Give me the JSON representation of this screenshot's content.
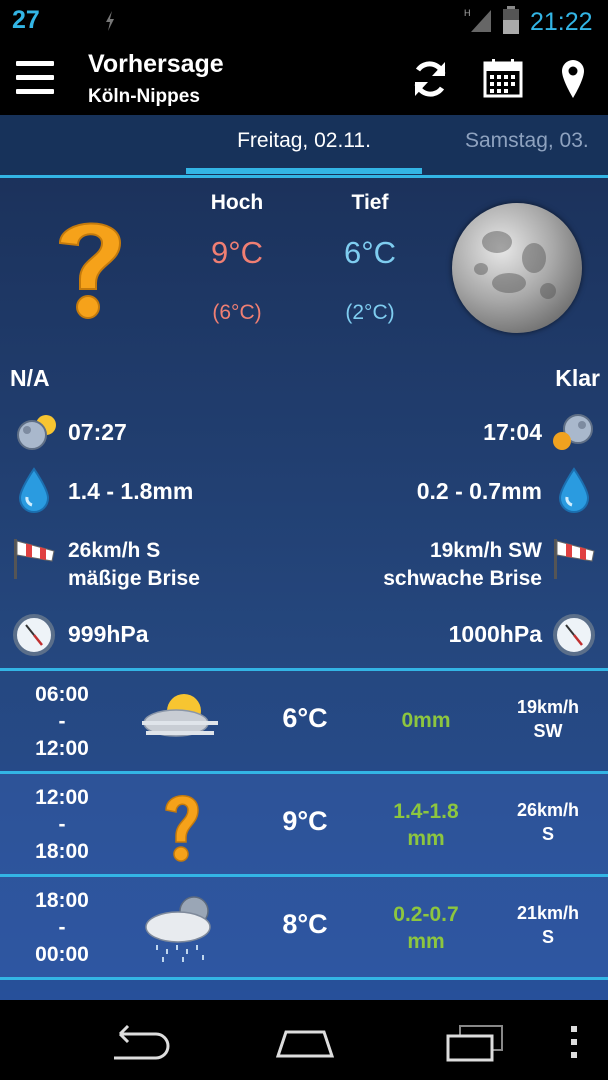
{
  "status_bar": {
    "notification_count": "27",
    "network_type": "H",
    "time": "21:22"
  },
  "app_bar": {
    "title": "Vorhersage",
    "subtitle": "Köln-Nippes",
    "actions": [
      "refresh-icon",
      "calendar-icon",
      "location-pin-icon"
    ]
  },
  "tabs": {
    "active": "Freitag, 02.11.",
    "next": "Samstag, 03."
  },
  "summary": {
    "high_label": "Hoch",
    "low_label": "Tief",
    "high_temp": "9°C",
    "low_temp": "6°C",
    "high_feels": "(6°C)",
    "low_feels": "(2°C)",
    "day_condition": "N/A",
    "night_condition": "Klar",
    "sunrise": "07:27",
    "sunset": "17:04",
    "precip_day": "1.4 - 1.8mm",
    "precip_night": "0.2 - 0.7mm",
    "wind_day_speed": "26km/h S",
    "wind_day_desc": "mäßige Brise",
    "wind_night_speed": "19km/h SW",
    "wind_night_desc": "schwache Brise",
    "pressure_day": "999hPa",
    "pressure_night": "1000hPa"
  },
  "forecast": [
    {
      "from": "06:00",
      "sep": "-",
      "to": "12:00",
      "icon": "partly-cloudy-fog-icon",
      "temp": "6°C",
      "precip_1": "0mm",
      "precip_2": "",
      "wind_speed": "19km/h",
      "wind_dir": "SW"
    },
    {
      "from": "12:00",
      "sep": "-",
      "to": "18:00",
      "icon": "unknown-question-icon",
      "temp": "9°C",
      "precip_1": "1.4-1.8",
      "precip_2": "mm",
      "wind_speed": "26km/h",
      "wind_dir": "S"
    },
    {
      "from": "18:00",
      "sep": "-",
      "to": "00:00",
      "icon": "night-cloud-rain-icon",
      "temp": "8°C",
      "precip_1": "0.2-0.7",
      "precip_2": "mm",
      "wind_speed": "21km/h",
      "wind_dir": "S"
    }
  ],
  "colors": {
    "accent": "#33b5e5",
    "high_temp": "#f07f73",
    "low_temp": "#7fcdf0",
    "precip_green": "#8dc63f"
  }
}
